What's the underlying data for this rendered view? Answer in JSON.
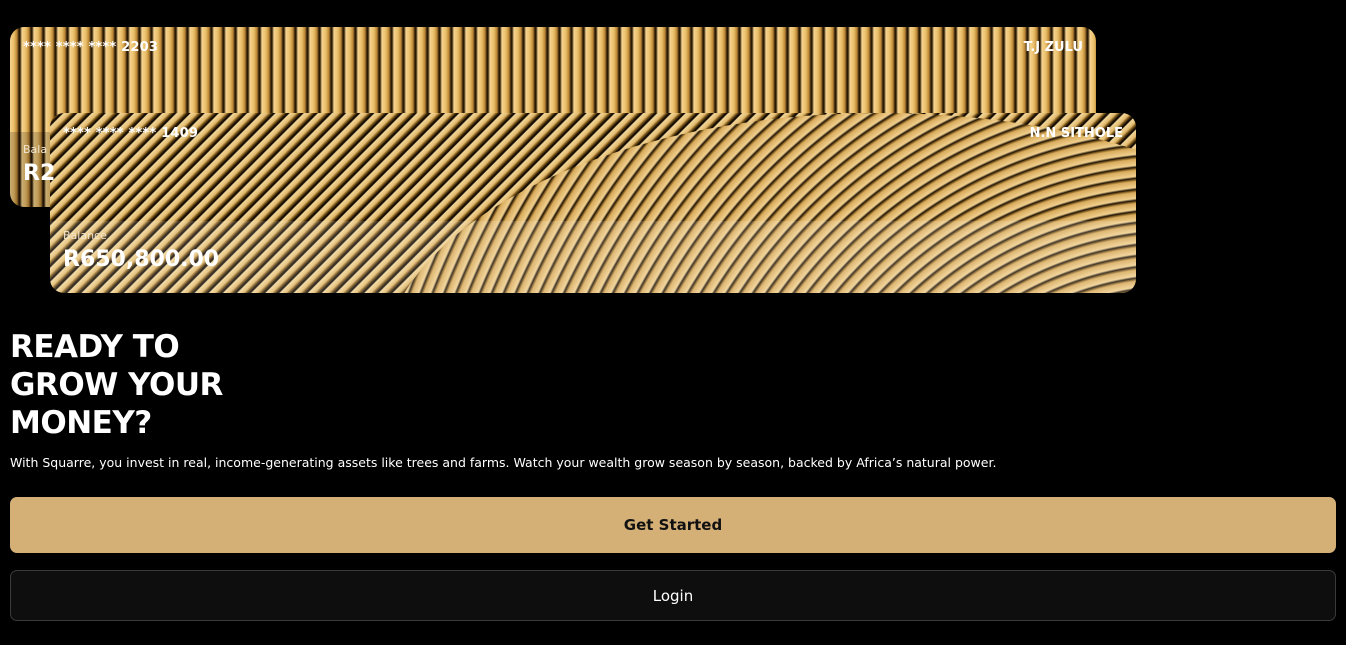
{
  "cards": [
    {
      "number": "**** **** **** 2203",
      "holder": "T.J ZULU",
      "balance_label": "Bala",
      "balance_value": "R2"
    },
    {
      "number": "**** **** **** 1409",
      "holder": "N.N SITHOLE",
      "balance_label": "Balance",
      "balance_value": "R650,800.00"
    }
  ],
  "hero": {
    "headline_line1": "READY TO",
    "headline_line2": "GROW YOUR",
    "headline_line3": "MONEY?",
    "description": "With Squarre, you invest in real, income-generating assets like trees and farms. Watch your wealth grow season by season, backed by Africa’s natural power."
  },
  "actions": {
    "primary_label": "Get Started",
    "secondary_label": "Login"
  },
  "colors": {
    "background": "#000000",
    "primary_button": "#d4af76",
    "secondary_button": "#0e0e0e",
    "card_gold": "#d9b46a"
  }
}
